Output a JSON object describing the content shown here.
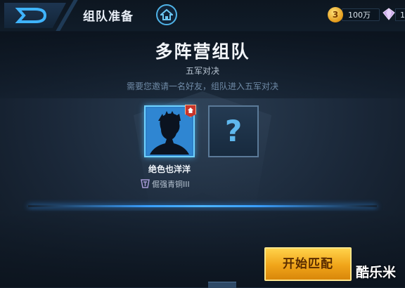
{
  "header": {
    "title": "组队准备",
    "back_icon": "back-arrow-icon",
    "home_icon": "home-icon"
  },
  "currency": {
    "gold_icon_glyph": "3",
    "gold_amount": "100万",
    "diamond_amount": "1"
  },
  "mode": {
    "title": "多阵营组队",
    "subtitle": "五军对决",
    "hint": "需要您邀请一名好友，组队进入五军对决"
  },
  "slots": [
    {
      "type": "player",
      "is_host": true,
      "name": "绝色也洋洋",
      "rank": "倔强青铜III",
      "avatar_icon": "player-avatar-icon"
    },
    {
      "type": "empty",
      "placeholder": "?"
    }
  ],
  "actions": {
    "start_match_label": "开始匹配"
  },
  "watermark": "酷乐米",
  "colors": {
    "accent_blue": "#4fb2e6",
    "slot_active": "#2d7fc8",
    "start_button": "#f0a419",
    "host_badge": "#c8352b"
  }
}
